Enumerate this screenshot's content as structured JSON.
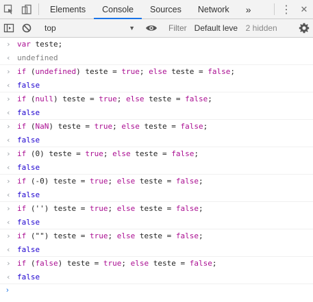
{
  "tabs": [
    {
      "label": "Elements",
      "active": false
    },
    {
      "label": "Console",
      "active": true
    },
    {
      "label": "Sources",
      "active": false
    },
    {
      "label": "Network",
      "active": false
    }
  ],
  "toolbar": {
    "context": "top",
    "filter_placeholder": "Filter",
    "levels": "Default leve",
    "hidden": "2 hidden"
  },
  "icons": {
    "inspect": "inspect-element-icon",
    "device": "device-toolbar-icon",
    "more_tabs": "»",
    "menu": "⋮",
    "close": "✕"
  },
  "console": [
    {
      "input": true,
      "html": "<span class='kw'>var</span> teste;"
    },
    {
      "input": false,
      "html": "<span class='res-undef'>undefined</span>"
    },
    {
      "input": true,
      "html": "<span class='kw'>if</span> (<span class='kw'>undefined</span>) teste = <span class='kw'>true</span>; <span class='kw'>else</span> teste = <span class='kw'>false</span>;"
    },
    {
      "input": false,
      "html": "<span class='res-bool'>false</span>"
    },
    {
      "input": true,
      "html": "<span class='kw'>if</span> (<span class='kw'>null</span>) teste = <span class='kw'>true</span>; <span class='kw'>else</span> teste = <span class='kw'>false</span>;"
    },
    {
      "input": false,
      "html": "<span class='res-bool'>false</span>"
    },
    {
      "input": true,
      "html": "<span class='kw'>if</span> (<span class='kw'>NaN</span>) teste = <span class='kw'>true</span>; <span class='kw'>else</span> teste = <span class='kw'>false</span>;"
    },
    {
      "input": false,
      "html": "<span class='res-bool'>false</span>"
    },
    {
      "input": true,
      "html": "<span class='kw'>if</span> (0) teste = <span class='kw'>true</span>; <span class='kw'>else</span> teste = <span class='kw'>false</span>;"
    },
    {
      "input": false,
      "html": "<span class='res-bool'>false</span>"
    },
    {
      "input": true,
      "html": "<span class='kw'>if</span> (-0) teste = <span class='kw'>true</span>; <span class='kw'>else</span> teste = <span class='kw'>false</span>;"
    },
    {
      "input": false,
      "html": "<span class='res-bool'>false</span>"
    },
    {
      "input": true,
      "html": "<span class='kw'>if</span> ('') teste = <span class='kw'>true</span>; <span class='kw'>else</span> teste = <span class='kw'>false</span>;"
    },
    {
      "input": false,
      "html": "<span class='res-bool'>false</span>"
    },
    {
      "input": true,
      "html": "<span class='kw'>if</span> (\"\") teste = <span class='kw'>true</span>; <span class='kw'>else</span> teste = <span class='kw'>false</span>;"
    },
    {
      "input": false,
      "html": "<span class='res-bool'>false</span>"
    },
    {
      "input": true,
      "html": "<span class='kw'>if</span> (<span class='kw'>false</span>) teste = <span class='kw'>true</span>; <span class='kw'>else</span> teste = <span class='kw'>false</span>;"
    },
    {
      "input": false,
      "html": "<span class='res-bool'>false</span>"
    }
  ],
  "colors": {
    "keyword": "#aa0d91",
    "accent": "#1a73e8",
    "result_false": "#1c00cf"
  }
}
